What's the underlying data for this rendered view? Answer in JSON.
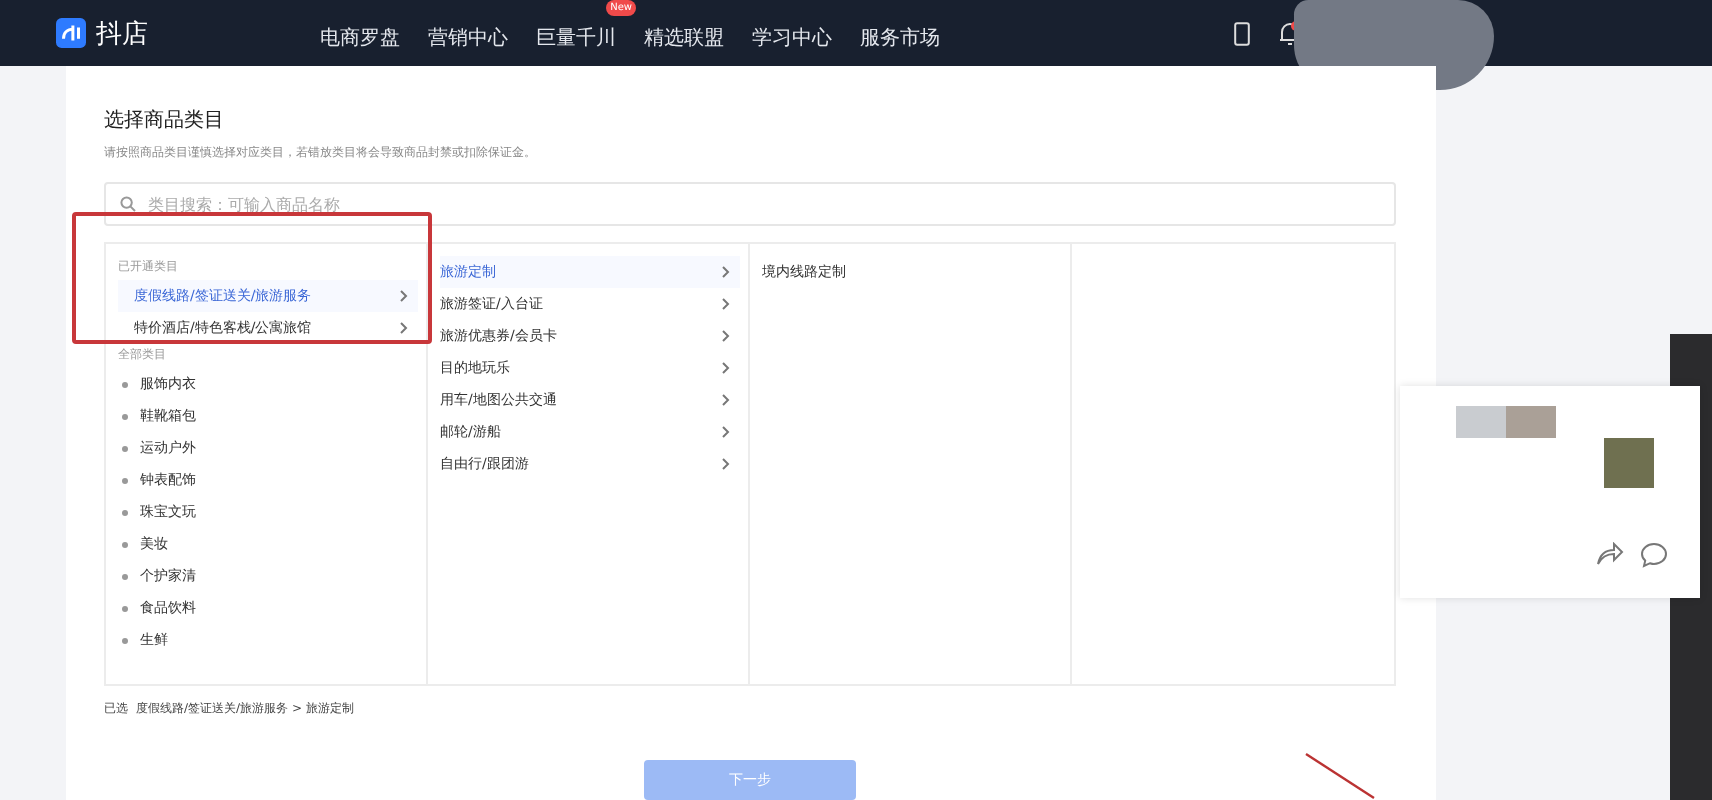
{
  "header": {
    "logo": "抖店",
    "nav": [
      {
        "label": "电商罗盘"
      },
      {
        "label": "营销中心"
      },
      {
        "label": "巨量千川",
        "badge": "New"
      },
      {
        "label": "精选联盟"
      },
      {
        "label": "学习中心"
      },
      {
        "label": "服务市场"
      }
    ],
    "notification_badge": true
  },
  "page": {
    "title": "选择商品类目",
    "hint": "请按照商品类目谨慎选择对应类目，若错放类目将会导致商品封禁或扣除保证金。",
    "search": {
      "placeholder": "类目搜索：可输入商品名称"
    },
    "columns": [
      {
        "sections": [
          {
            "heading": "已开通类目",
            "kind": "opened",
            "items": [
              {
                "label": "度假线路/签证送关/旅游服务",
                "selected": true,
                "has_children": true
              },
              {
                "label": "特价酒店/特色客栈/公寓旅馆",
                "selected": false,
                "has_children": true
              }
            ]
          },
          {
            "heading": "全部类目",
            "kind": "all",
            "items": [
              {
                "label": "服饰内衣",
                "selected": false,
                "has_children": false
              },
              {
                "label": "鞋靴箱包",
                "selected": false,
                "has_children": false
              },
              {
                "label": "运动户外",
                "selected": false,
                "has_children": false
              },
              {
                "label": "钟表配饰",
                "selected": false,
                "has_children": false
              },
              {
                "label": "珠宝文玩",
                "selected": false,
                "has_children": false
              },
              {
                "label": "美妆",
                "selected": false,
                "has_children": false
              },
              {
                "label": "个护家清",
                "selected": false,
                "has_children": false
              },
              {
                "label": "食品饮料",
                "selected": false,
                "has_children": false
              },
              {
                "label": "生鲜",
                "selected": false,
                "has_children": false
              }
            ]
          }
        ]
      },
      {
        "sections": [
          {
            "kind": "plain",
            "items": [
              {
                "label": "旅游定制",
                "selected": true,
                "has_children": true
              },
              {
                "label": "旅游签证/入台证",
                "selected": false,
                "has_children": true
              },
              {
                "label": "旅游优惠券/会员卡",
                "selected": false,
                "has_children": true
              },
              {
                "label": "目的地玩乐",
                "selected": false,
                "has_children": true
              },
              {
                "label": "用车/地图公共交通",
                "selected": false,
                "has_children": true
              },
              {
                "label": "邮轮/游船",
                "selected": false,
                "has_children": true
              },
              {
                "label": "自由行/跟团游",
                "selected": false,
                "has_children": true
              }
            ]
          }
        ]
      },
      {
        "sections": [
          {
            "kind": "plain",
            "items": [
              {
                "label": "境内线路定制",
                "selected": false,
                "has_children": false
              }
            ]
          }
        ]
      }
    ],
    "selected_label": "已选",
    "selected_path": "度假线路/签证送关/旅游服务 > 旅游定制",
    "next_button": {
      "label": "下一步",
      "disabled": true
    }
  }
}
